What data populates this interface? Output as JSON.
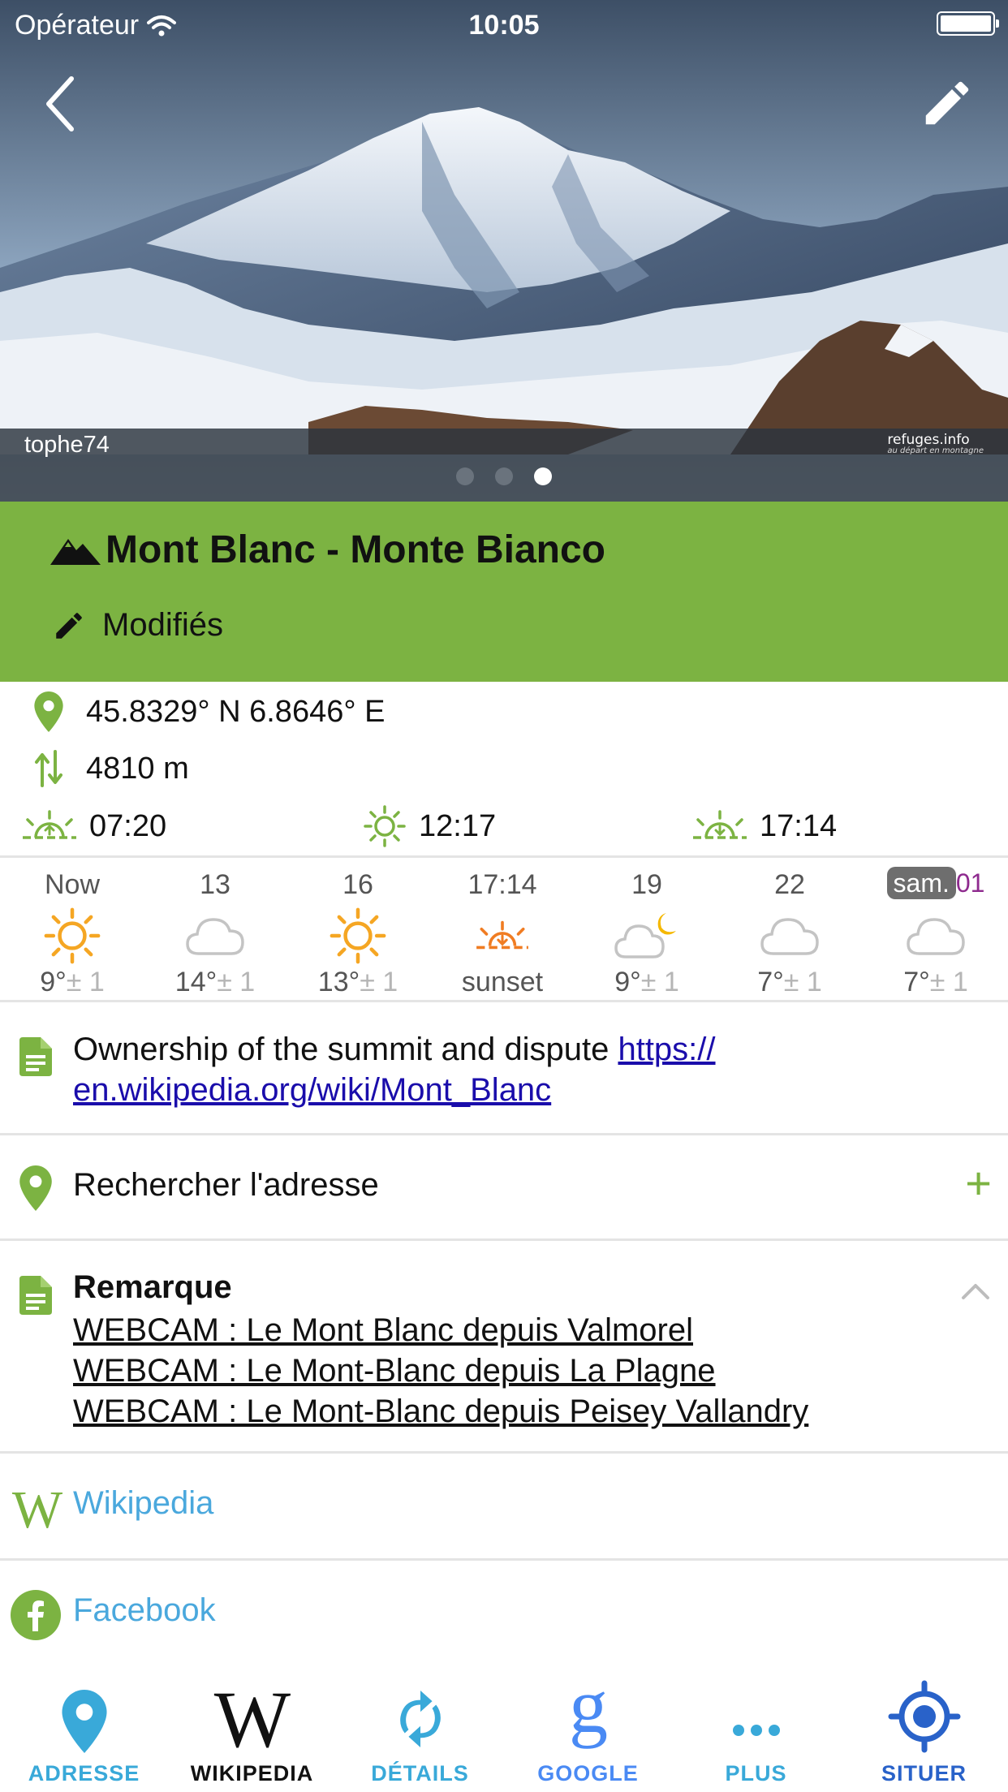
{
  "status": {
    "carrier": "Opérateur",
    "time": "10:05"
  },
  "hero": {
    "credit": "tophe74",
    "watermark_title": "refuges.info",
    "watermark_sub": "au départ en montagne",
    "page_count": 3,
    "active_page": 3
  },
  "header": {
    "title": "Mont Blanc - Monte Bianco",
    "modified_label": "Modifiés"
  },
  "info": {
    "coordinates": "45.8329° N 6.8646° E",
    "altitude": "4810 m",
    "sunrise": "07:20",
    "noon": "12:17",
    "sunset": "17:14"
  },
  "forecast": [
    {
      "time": "Now",
      "icon": "sun-icon",
      "temp": "9°",
      "pm": "± 1"
    },
    {
      "time": "13",
      "icon": "cloud-icon",
      "temp": "14°",
      "pm": "± 1"
    },
    {
      "time": "16",
      "icon": "sun-icon",
      "temp": "13°",
      "pm": "± 1"
    },
    {
      "time": "17:14",
      "icon": "sunset-icon",
      "temp": "sunset",
      "pm": ""
    },
    {
      "time": "19",
      "icon": "cloud-moon-icon",
      "temp": "9°",
      "pm": "± 1"
    },
    {
      "time": "22",
      "icon": "cloud-icon",
      "temp": "7°",
      "pm": "± 1"
    },
    {
      "time": "01",
      "day_badge": "sam.",
      "icon": "cloud-icon",
      "temp": "7°",
      "pm": "± 1"
    }
  ],
  "description": {
    "text": "Ownership of the summit and dispute ",
    "link": "https://en.wikipedia.org/wiki/Mont_Blanc",
    "link_line1": "https://",
    "link_line2": "en.wikipedia.org/wiki/Mont_Blanc"
  },
  "address": {
    "label": "Rechercher l'adresse"
  },
  "remark": {
    "title": "Remarque",
    "links": [
      "WEBCAM : Le Mont Blanc depuis Valmorel",
      "WEBCAM : Le Mont-Blanc depuis La Plagne",
      "WEBCAM : Le Mont-Blanc depuis Peisey Vallandry"
    ]
  },
  "social": {
    "wikipedia": "Wikipedia",
    "facebook": "Facebook"
  },
  "tabs": [
    {
      "label": "ADRESSE",
      "icon": "map-pin-icon",
      "color": "#39a9d9"
    },
    {
      "label": "WIKIPEDIA",
      "icon": "wikipedia-icon",
      "color": "#111111"
    },
    {
      "label": "DÉTAILS",
      "icon": "refresh-icon",
      "color": "#39a9d9"
    },
    {
      "label": "GOOGLE",
      "icon": "google-icon",
      "color": "#4a8af4"
    },
    {
      "label": "PLUS",
      "icon": "more-icon",
      "color": "#39a9d9"
    },
    {
      "label": "SITUER",
      "icon": "locate-icon",
      "color": "#2962c9"
    }
  ],
  "colors": {
    "accent_green": "#7cb342",
    "link_blue": "#4aa8dd",
    "sun_orange": "#f5a623"
  }
}
